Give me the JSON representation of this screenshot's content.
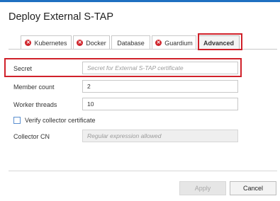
{
  "dialog": {
    "title": "Deploy External S-TAP"
  },
  "tabs": [
    {
      "label": "Kubernetes",
      "status_icon": "error-icon"
    },
    {
      "label": "Docker",
      "status_icon": "error-icon"
    },
    {
      "label": "Database",
      "status_icon": ""
    },
    {
      "label": "Guardium",
      "status_icon": "error-icon"
    },
    {
      "label": "Advanced",
      "status_icon": "",
      "active": true
    }
  ],
  "form": {
    "secret": {
      "label": "Secret",
      "value": "",
      "placeholder": "Secret for External S-TAP certificate"
    },
    "member_count": {
      "label": "Member count",
      "value": "2"
    },
    "worker_threads": {
      "label": "Worker threads",
      "value": "10"
    },
    "verify_collector": {
      "label": "Verify collector certificate",
      "checked": false
    },
    "collector_cn": {
      "label": "Collector CN",
      "value": "",
      "placeholder": "Regular expression allowed",
      "disabled": true
    }
  },
  "buttons": {
    "apply": "Apply",
    "cancel": "Cancel"
  },
  "colors": {
    "accent": "#1f70c1",
    "error": "#d0252c",
    "highlight": "#d0212a"
  }
}
